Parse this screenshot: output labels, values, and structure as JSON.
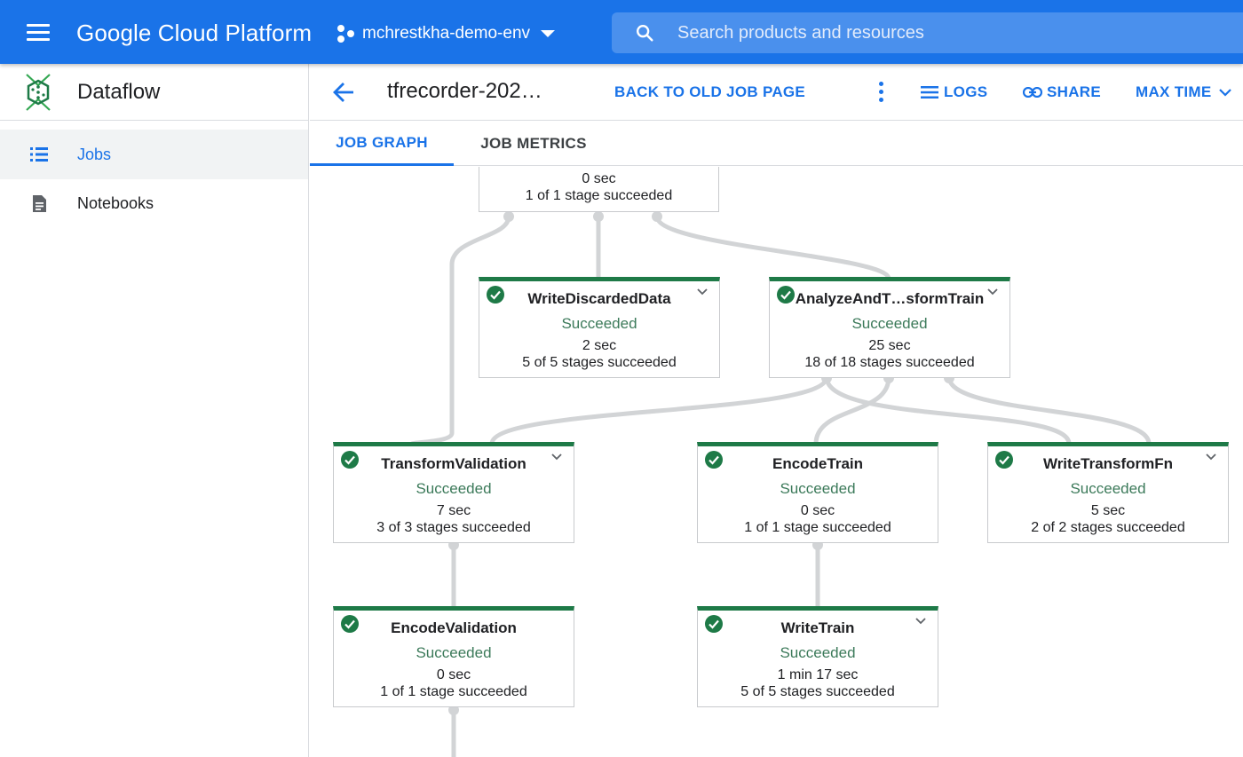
{
  "topbar": {
    "brand": "Google Cloud Platform",
    "project": "mchrestkha-demo-env",
    "search_placeholder": "Search products and resources",
    "color": "#1a73e8"
  },
  "sidebar": {
    "product": "Dataflow",
    "items": [
      {
        "label": "Jobs",
        "icon": "list-icon",
        "active": true
      },
      {
        "label": "Notebooks",
        "icon": "notebook-icon",
        "active": false
      }
    ]
  },
  "header": {
    "job_title": "tfrecorder-202…",
    "back_to_old": "BACK TO OLD JOB PAGE",
    "logs": "LOGS",
    "share": "SHARE",
    "max_time": "MAX TIME"
  },
  "tabs": [
    {
      "label": "JOB GRAPH",
      "active": true
    },
    {
      "label": "JOB METRICS",
      "active": false
    }
  ],
  "graph": {
    "status_color": "#1e7a47",
    "top_node": {
      "time": "0 sec",
      "stages": "1 of 1 stage succeeded"
    },
    "nodes": [
      {
        "name": "WriteDiscardedData",
        "status": "Succeeded",
        "time": "2 sec",
        "stages": "5 of 5 stages succeeded"
      },
      {
        "name": "AnalyzeAndT…sformTrain",
        "status": "Succeeded",
        "time": "25 sec",
        "stages": "18 of 18 stages succeeded"
      },
      {
        "name": "TransformValidation",
        "status": "Succeeded",
        "time": "7 sec",
        "stages": "3 of 3 stages succeeded"
      },
      {
        "name": "EncodeTrain",
        "status": "Succeeded",
        "time": "0 sec",
        "stages": "1 of 1 stage succeeded"
      },
      {
        "name": "WriteTransformFn",
        "status": "Succeeded",
        "time": "5 sec",
        "stages": "2 of 2 stages succeeded"
      },
      {
        "name": "EncodeValidation",
        "status": "Succeeded",
        "time": "0 sec",
        "stages": "1 of 1 stage succeeded"
      },
      {
        "name": "WriteTrain",
        "status": "Succeeded",
        "time": "1 min 17 sec",
        "stages": "5 of 5 stages succeeded"
      }
    ]
  }
}
